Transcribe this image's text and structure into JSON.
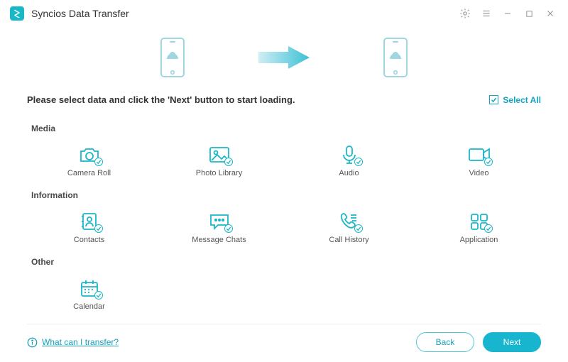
{
  "app": {
    "title": "Syncios Data Transfer"
  },
  "instruct": "Please select data and click the 'Next' button to start loading.",
  "select_all": "Select All",
  "sections": {
    "media": "Media",
    "information": "Information",
    "other": "Other"
  },
  "tiles": {
    "camera_roll": "Camera Roll",
    "photo_library": "Photo Library",
    "audio": "Audio",
    "video": "Video",
    "contacts": "Contacts",
    "message_chats": "Message Chats",
    "call_history": "Call History",
    "application": "Application",
    "calendar": "Calendar"
  },
  "help": "What can I transfer?",
  "buttons": {
    "back": "Back",
    "next": "Next"
  },
  "colors": {
    "accent": "#19b8c8"
  }
}
